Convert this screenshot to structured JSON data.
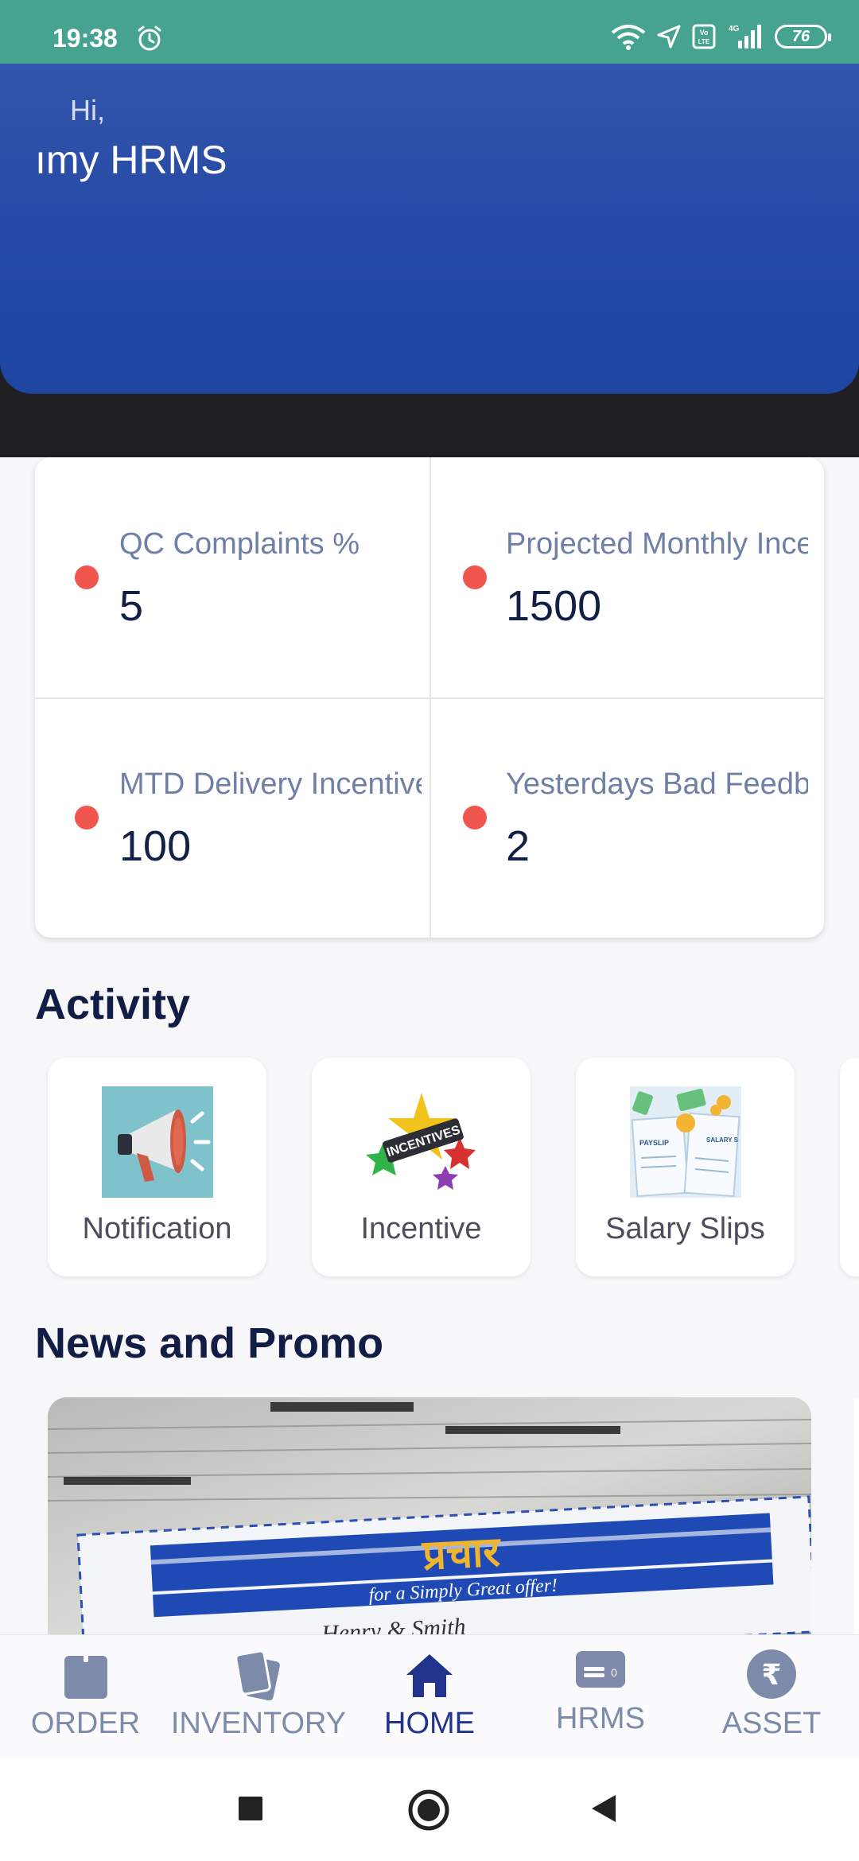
{
  "status_bar": {
    "time": "19:38",
    "battery": "76",
    "network": "4G"
  },
  "hero": {
    "greeting": "Hi,",
    "name": "ımy HRMS"
  },
  "stats": [
    {
      "label": "QC Complaints %",
      "value": "5"
    },
    {
      "label": "Projected Monthly Ince",
      "value": "1500"
    },
    {
      "label": "MTD Delivery Incentive",
      "value": "100"
    },
    {
      "label": "Yesterdays Bad Feedba",
      "value": "2"
    }
  ],
  "activity": {
    "title": "Activity",
    "items": [
      {
        "label": "Notification",
        "icon": "megaphone-icon"
      },
      {
        "label": "Incentive",
        "icon": "incentives-icon"
      },
      {
        "label": "Salary Slips",
        "icon": "payslip-icon"
      }
    ]
  },
  "news": {
    "title": "News and Promo",
    "banner_text": "for a Simply Great offer!",
    "banner_brand": "Henry & Smith"
  },
  "bottom_nav": [
    {
      "label": "ORDER",
      "icon": "bag-icon"
    },
    {
      "label": "INVENTORY",
      "icon": "cards-icon"
    },
    {
      "label": "HOME",
      "icon": "home-icon"
    },
    {
      "label": "HRMS",
      "icon": "id-card-icon"
    },
    {
      "label": "ASSET",
      "icon": "rupee-icon"
    }
  ],
  "colors": {
    "accent": "#1d45a2",
    "status": "#45a38f",
    "dot": "#f0564e",
    "nav_active": "#22338e"
  }
}
